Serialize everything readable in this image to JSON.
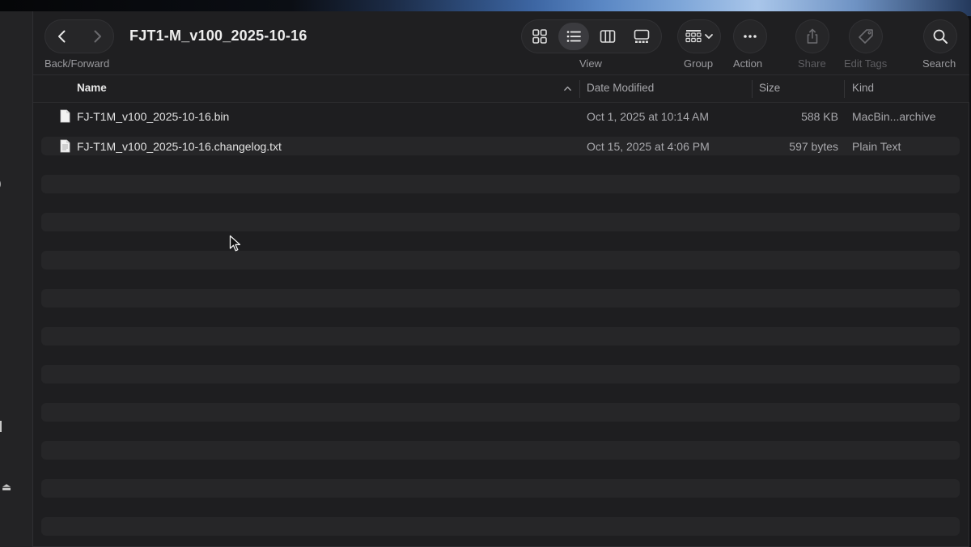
{
  "window": {
    "title": "FJT1-M_v100_2025-10-16"
  },
  "toolbar": {
    "back_forward_label": "Back/Forward",
    "view_label": "View",
    "group_label": "Group",
    "action_label": "Action",
    "share_label": "Share",
    "edit_tags_label": "Edit Tags",
    "search_label": "Search",
    "active_view": "list"
  },
  "columns": {
    "name": "Name",
    "date_modified": "Date Modified",
    "size": "Size",
    "kind": "Kind"
  },
  "files": [
    {
      "name": "FJ-T1M_v100_2025-10-16.bin",
      "date_modified": "Oct 1, 2025 at 10:14 AM",
      "size": "588 KB",
      "kind": "MacBin...archive",
      "icon": "document-icon"
    },
    {
      "name": "FJ-T1M_v100_2025-10-16.changelog.txt",
      "date_modified": "Oct 15, 2025 at 4:06 PM",
      "size": "597 bytes",
      "kind": "Plain Text",
      "icon": "text-document-icon"
    }
  ],
  "sidebar": {
    "partial_glyphs": [
      ")",
      "⏏"
    ]
  },
  "colors": {
    "window_bg": "#1e1e20",
    "row_stripe": "#262628",
    "text_primary": "#e2e2e2",
    "text_secondary": "#a9a9ad"
  }
}
